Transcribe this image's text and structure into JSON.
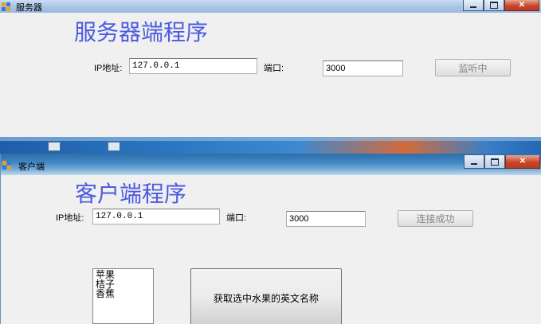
{
  "server_window": {
    "title": "服务器",
    "heading": "服务器端程序",
    "ip_label": "IP地址:",
    "ip_value": "127.0.0.1",
    "port_label": "端口:",
    "port_value": "3000",
    "listen_button": "监听中"
  },
  "client_window": {
    "title": "客户端",
    "heading": "客户端程序",
    "ip_label": "IP地址:",
    "ip_value": "127.0.0.1",
    "port_label": "端口:",
    "port_value": "3000",
    "connect_button": "连接成功",
    "fruit_list": [
      "苹果",
      "桔子",
      "香蕉"
    ],
    "get_button": "获取选中水果的英文名称"
  },
  "window_controls": {
    "close": "✕"
  }
}
